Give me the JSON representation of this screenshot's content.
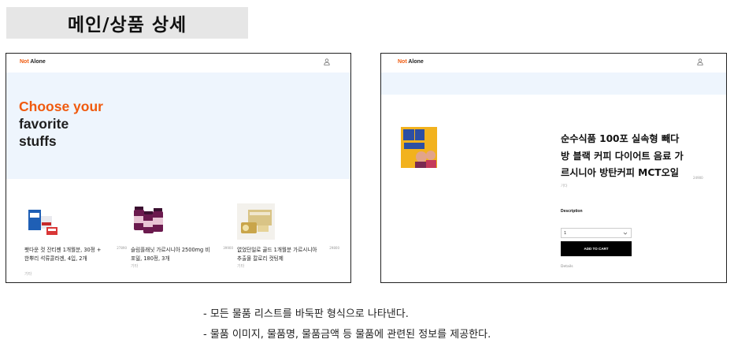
{
  "slide": {
    "title": "메인/상품 상세",
    "notes": [
      "- 모든 물품 리스트를 바둑판 형식으로 나타낸다.",
      "- 물품 이미지, 물품명, 물품금액 등 물품에 관련된 정보를 제공한다."
    ]
  },
  "main_page": {
    "brand": {
      "accent": "Not",
      "rest": " Alone"
    },
    "icons": {
      "account": "user-icon"
    },
    "hero": {
      "line1": "Choose your",
      "line2": "favorite",
      "line3": "stuffs"
    },
    "products": [
      {
        "name": "팻다운 컷 잔티젠 1개월분, 30정 + 한뿌리 석류콜라겐, 4입, 2개",
        "price": "27890",
        "category": "기타"
      },
      {
        "name": "슬림플래닛 가르시니아 2500mg 비포밀, 180정, 3개",
        "price": "39900",
        "category": "기타"
      },
      {
        "name": "없었던일로 골드 1개월분 가르시니아 추출물 칼로리 컷팅제",
        "price": "29800",
        "category": "기타"
      }
    ]
  },
  "detail_page": {
    "brand": {
      "accent": "Not",
      "rest": " Alone"
    },
    "icons": {
      "account": "user-icon",
      "select": "chevron-down-icon"
    },
    "product": {
      "title_lines": [
        "순수식품 100포 실속형 빼다",
        "방 블랙 커피 다이어트 음료 가",
        "르시니아 방탄커피 MCT오일"
      ],
      "price": "24900",
      "category": "기타",
      "description_label": "Description",
      "quantity": "1",
      "add_to_cart": "ADD TO CART",
      "details_link": "Details"
    }
  },
  "colors": {
    "accent": "#f05a0e",
    "hero_bg": "#eef5fd",
    "button_bg": "#000000"
  }
}
